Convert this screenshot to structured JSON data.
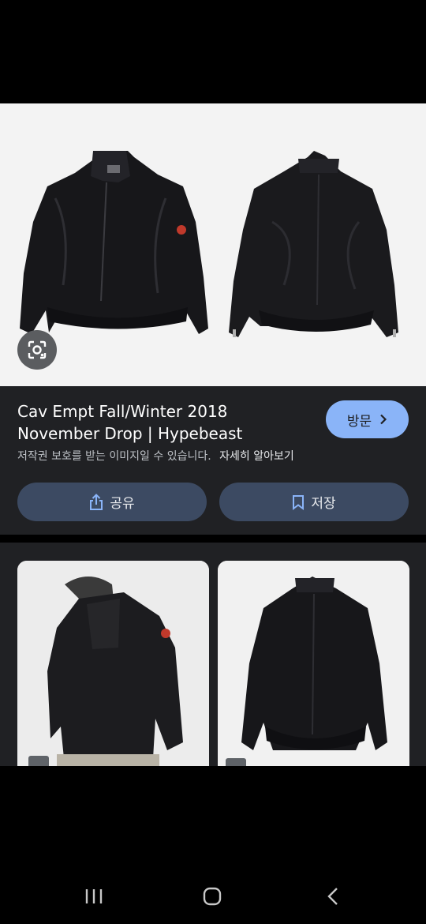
{
  "result": {
    "title_line1": "Cav Empt Fall/Winter 2018",
    "title_line2": "November Drop | Hypebeast",
    "visit_label": "방문",
    "copyright_notice": "저작권 보호를 받는 이미지일 수 있습니다.",
    "learn_more": "자세히 알아보기",
    "share_label": "공유",
    "save_label": "저장"
  },
  "colors": {
    "card_bg": "#202124",
    "visit_button": "#8ab4f8",
    "action_button": "#3c4a62",
    "hero_bg": "#f3f3f3"
  },
  "icons": [
    "google-lens-icon",
    "chevron-right-icon",
    "share-icon",
    "bookmark-icon",
    "recents-icon",
    "home-icon",
    "back-icon"
  ]
}
